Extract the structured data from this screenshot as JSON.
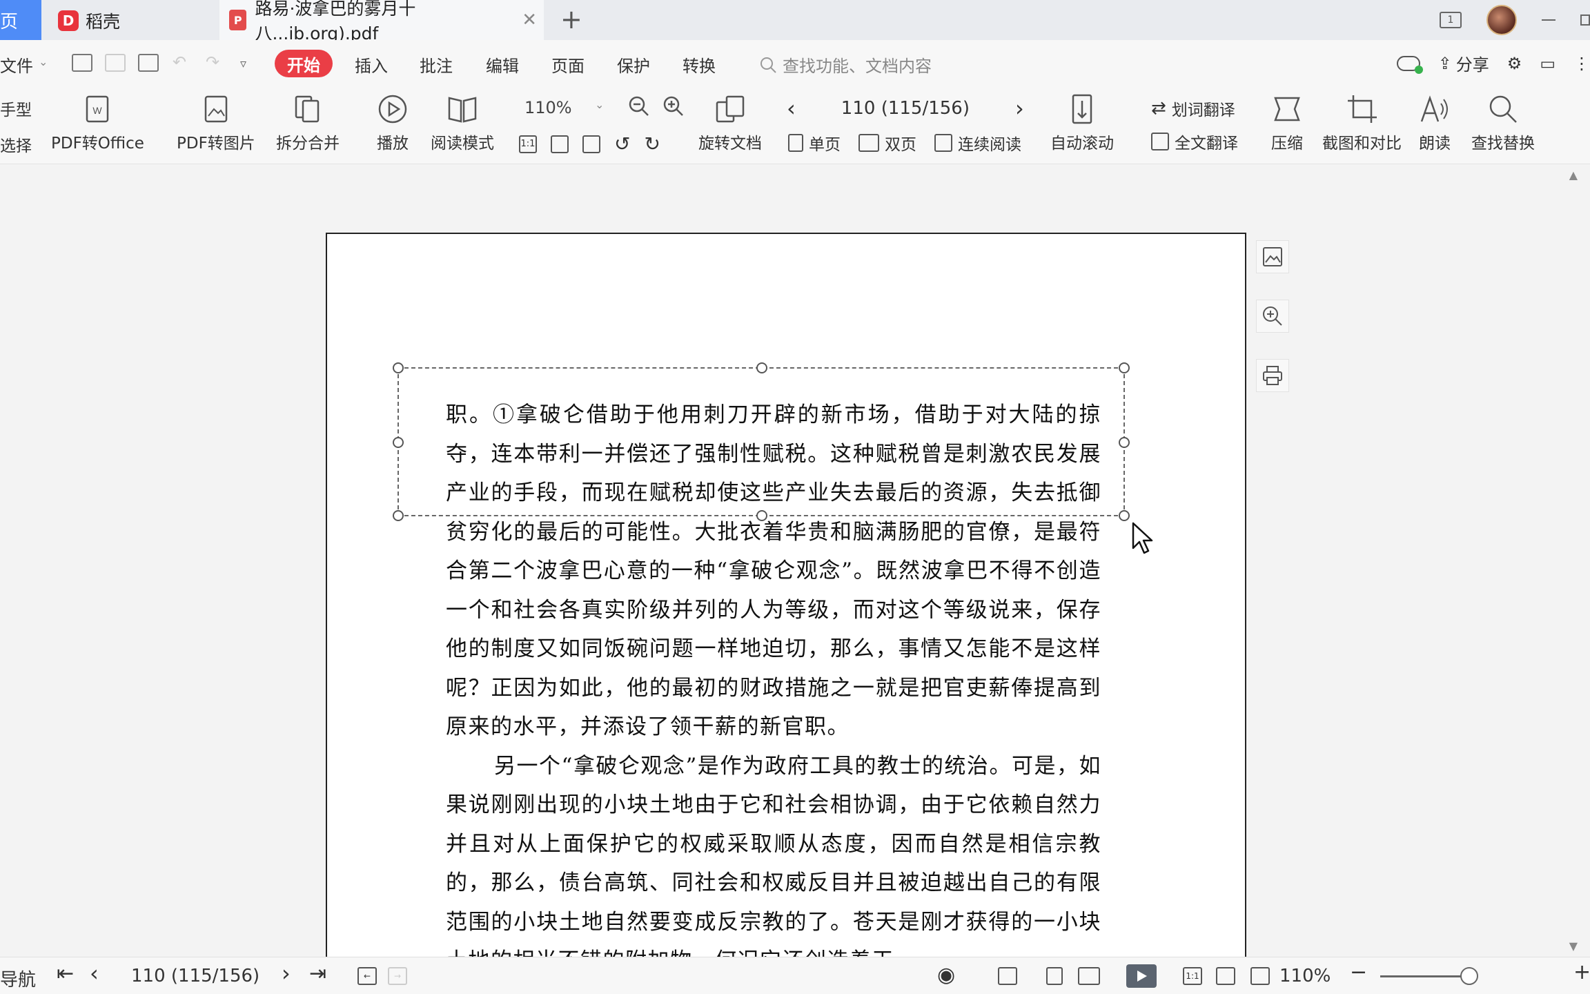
{
  "titlebar": {
    "home_tab": "页",
    "daoke_tab": "稻壳",
    "daoke_logo": "D",
    "doc_tab": "路易·波拿巴的雾月十八...ib.org).pdf",
    "pdf_logo": "P",
    "close_glyph": "✕",
    "new_tab_glyph": "+",
    "page_indicator": "1"
  },
  "menubar": {
    "file": "文件",
    "active": "开始",
    "items": [
      "插入",
      "批注",
      "编辑",
      "页面",
      "保护",
      "转换"
    ],
    "search_placeholder": "查找功能、文档内容",
    "share": "分享"
  },
  "ribbon": {
    "hand_tool": "手型",
    "select_tool": "选择",
    "pdf_to_office": "PDF转Office",
    "pdf_to_image": "PDF转图片",
    "split_merge": "拆分合并",
    "play": "播放",
    "read_mode": "阅读模式",
    "zoom": "110%",
    "rotate_doc": "旋转文档",
    "page_indicator": "110 (115/156)",
    "single_page": "单页",
    "double_page": "双页",
    "continuous": "连续阅读",
    "auto_scroll": "自动滚动",
    "word_translate": "划词翻译",
    "full_translate": "全文翻译",
    "compress": "压缩",
    "screenshot_compare": "截图和对比",
    "read_aloud": "朗读",
    "find_replace": "查找替换"
  },
  "document": {
    "paragraphs": [
      "职。①拿破仑借助于他用刺刀开辟的新市场，借助于对大陆的掠夺，连本带利一并偿还了强制性赋税。这种赋税曾是刺激农民发展产业的手段，而现在赋税却使这些产业失去最后的资源，失去抵御贫穷化的最后的可能性。大批衣着华贵和脑满肠肥的官僚，是最符合第二个波拿巴心意的一种“拿破仑观念”。既然波拿巴不得不创造一个和社会各真实阶级并列的人为等级，而对这个等级说来，保存他的制度又如同饭碗问题一样地迫切，那么，事情又怎能不是这样呢？正因为如此，他的最初的财政措施之一就是把官吏薪俸提高到原来的水平，并添设了领干薪的新官职。",
      "另一个“拿破仑观念”是作为政府工具的教士的统治。可是，如果说刚刚出现的小块土地由于它和社会相协调，由于它依赖自然力并且对从上面保护它的权威采取顺从态度，因而自然是相信宗教的，那么，债台高筑、同社会和权威反目并且被迫越出自己的有限范围的小块土地自然要变成反宗教的了。苍天是刚才获得的一小块土地的相当不错的附加物，何况它还创造着天"
    ]
  },
  "statusbar": {
    "nav": "导航",
    "page_indicator": "110 (115/156)",
    "zoom": "110%"
  }
}
